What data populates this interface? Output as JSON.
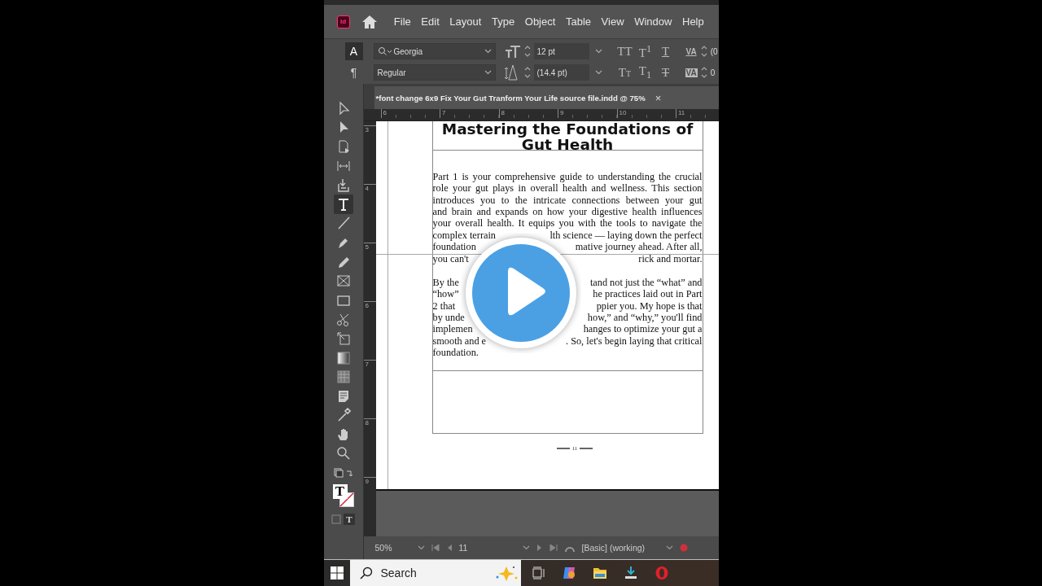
{
  "app_logo": "Id",
  "menu": [
    "File",
    "Edit",
    "Layout",
    "Type",
    "Object",
    "Table",
    "View",
    "Window",
    "Help"
  ],
  "control_panel": {
    "rows": [
      {
        "mode": {
          "label": "A",
          "selected": true
        },
        "field": {
          "kind": "search",
          "value": "Georgia"
        },
        "size": {
          "kind": "font-size",
          "value": "12 pt"
        },
        "styles": [
          {
            "label": "TT",
            "kind": "allcaps"
          },
          {
            "label": "T$^{1}$",
            "kind": "plain"
          },
          {
            "label": "T",
            "kind": "underline"
          }
        ],
        "kern": {
          "kind": "kerning",
          "label": "VA",
          "value": "(0"
        }
      },
      {
        "mode": {
          "label": "¶",
          "selected": false
        },
        "field": {
          "kind": "plain",
          "value": "Regular"
        },
        "size": {
          "kind": "leading",
          "value": "(14.4 pt)"
        },
        "styles": [
          {
            "label": "TT",
            "kind": "smallcaps"
          },
          {
            "label": "T$_{1}$",
            "kind": "plain"
          },
          {
            "label": "T",
            "kind": "strike"
          }
        ],
        "kern": {
          "kind": "tracking",
          "label": "VA",
          "value": "0"
        }
      }
    ]
  },
  "tools": [
    {
      "kind": "select",
      "selected": false
    },
    {
      "kind": "direct",
      "selected": false
    },
    {
      "kind": "page",
      "selected": false
    },
    {
      "kind": "gap",
      "selected": false
    },
    {
      "kind": "collector",
      "selected": false
    },
    {
      "kind": "type",
      "selected": true
    },
    {
      "kind": "line",
      "selected": false
    },
    {
      "kind": "pen",
      "selected": false
    },
    {
      "kind": "pencil",
      "selected": false
    },
    {
      "kind": "frame",
      "selected": false
    },
    {
      "kind": "rect",
      "selected": false
    },
    {
      "kind": "scissors",
      "selected": false
    },
    {
      "kind": "transform",
      "selected": false
    },
    {
      "kind": "gradient",
      "selected": false
    },
    {
      "kind": "feather",
      "selected": false
    },
    {
      "kind": "note",
      "selected": false
    },
    {
      "kind": "eyedropper",
      "selected": false
    },
    {
      "kind": "hand",
      "selected": false
    },
    {
      "kind": "zoom",
      "selected": false
    }
  ],
  "fill_stroke": {
    "label": "T"
  },
  "view_mode": {
    "label": "T"
  },
  "document_tab": {
    "title": "*font change 6x9 Fix Your Gut Tranform Your Life source file.indd @ 75%",
    "close": "×"
  },
  "ruler": {
    "horizontal": [
      "6",
      "7",
      "8",
      "9",
      "10",
      "11"
    ],
    "vertical": [
      "3",
      "4",
      "5",
      "6",
      "7",
      "8",
      "9"
    ]
  },
  "page": {
    "heading": "Mastering the Foundations of Gut Health",
    "paragraphs": [
      {
        "lines": [
          [
            "Part 1 is your comprehensive guide to understanding the crucial"
          ],
          [
            "role your gut plays in overall health and wellness. This section"
          ],
          [
            "introduces you to the intricate connections between your gut"
          ],
          [
            "and brain and expands on how your digestive health influences"
          ],
          [
            "your overall health. It equips you with the tools to navigate the"
          ],
          [
            "complex terrain",
            "lth science  — laying down the perfect"
          ],
          [
            "foundation",
            "mative journey ahead. After all,"
          ],
          [
            "you can't",
            "rick and mortar."
          ]
        ]
      },
      {
        "lines": [
          [
            "By the",
            "tand not just the “what” and"
          ],
          [
            "“how”",
            "he practices laid out in Part"
          ],
          [
            "2 that",
            "ppier you. My hope is that"
          ],
          [
            "by unde",
            "how,” and “why,” you'll find"
          ],
          [
            "implemen",
            "hanges to optimize your gut a"
          ],
          [
            "smooth and e",
            ". So, let's begin laying that critical"
          ],
          [
            "foundation."
          ]
        ]
      }
    ],
    "folio": "11"
  },
  "status_bar": {
    "zoom": "50%",
    "page": "11",
    "profile": "[Basic] (working)"
  },
  "taskbar": {
    "search_placeholder": "Search"
  }
}
